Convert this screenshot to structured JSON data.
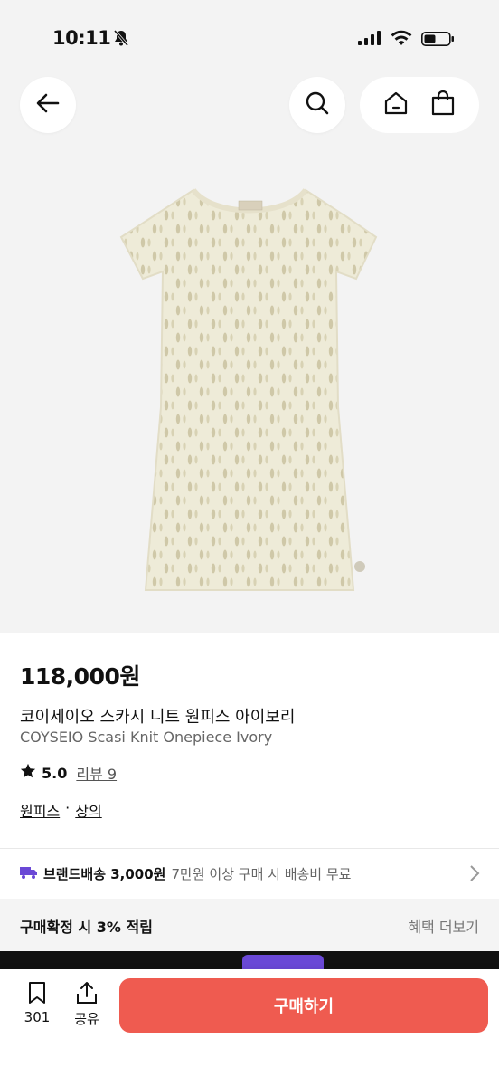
{
  "status_bar": {
    "time": "10:11",
    "icons": [
      "bell-slash-icon",
      "signal-icon",
      "wifi-icon",
      "battery-icon"
    ]
  },
  "header": {
    "icons": [
      "back-arrow-icon",
      "search-icon",
      "home-icon",
      "shopping-bag-icon"
    ]
  },
  "product": {
    "image_description_icon": "dress-image",
    "price": "118,000원",
    "name_ko": "코이세이오 스카시 니트 원피스 아이보리",
    "name_en": "COYSEIO Scasi Knit Onepiece Ivory",
    "rating": "5.0",
    "review_label": "리뷰 9",
    "categories": [
      "원피스",
      "상의"
    ],
    "category_separator": "·"
  },
  "shipping": {
    "label": "브랜드배송 3,000원",
    "note": "7만원 이상 구매 시 배송비 무료"
  },
  "benefit": {
    "left": "구매확정 시 3% 적립",
    "right": "혜택 더보기"
  },
  "bottom_bar": {
    "like_count": "301",
    "share_label": "공유",
    "buy_label": "구매하기"
  },
  "colors": {
    "accent": "#ef5b50",
    "truck": "#6a48d6"
  }
}
